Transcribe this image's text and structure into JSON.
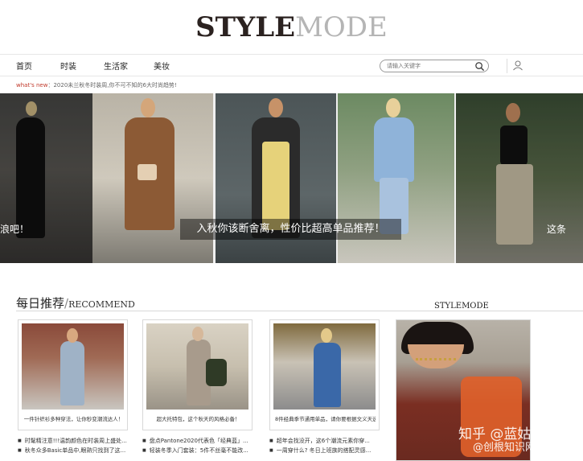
{
  "logo": {
    "bold": "STYLE",
    "light": "MODE"
  },
  "nav": {
    "items": [
      "首页",
      "时装",
      "生活家",
      "美妆"
    ],
    "search_placeholder": "请输入关键字"
  },
  "ticker": {
    "label": "what's new",
    "text": "：2020未兰秋冬时装周,你不可不知的6大时尚趋势!"
  },
  "carousel": {
    "caption": "入秋你该断舍离，性价比超高单品推荐！",
    "side_left": "浪吧！",
    "side_right": "这条"
  },
  "recommend": {
    "title_cn": "每日推荐",
    "title_en": "RECOMMEND",
    "side_brand": "STYLEMODE"
  },
  "cards": [
    {
      "text": "一件针织衫多种穿法，让你秒变潮流达人！"
    },
    {
      "text": "超大托特包，这个秋天的风格必备！"
    },
    {
      "text": "8件经典季节通用单品，请你要根据文义天选工作..."
    }
  ],
  "lists": [
    [
      "时髦精注意!!!温韵颜色在时装周上盛处...",
      "秋冬众多Basic单品中,眼熟只找到了这..."
    ],
    [
      "盘点Pantone2020代表色「经典蓝」...",
      "轻装冬季入门套装：5件不丝毫不能改..."
    ],
    [
      "超年会找没开，这6个潮流元素你穿...",
      "一周穿什么? 冬日上班族的搭配灵感..."
    ]
  ],
  "watermark": {
    "line1": "知乎 @蓝姑娘",
    "line2": "@创根知识网"
  },
  "colors": {
    "accent": "#c0392b",
    "logo_dark": "#2b2220",
    "logo_light": "#b5b5b5"
  }
}
